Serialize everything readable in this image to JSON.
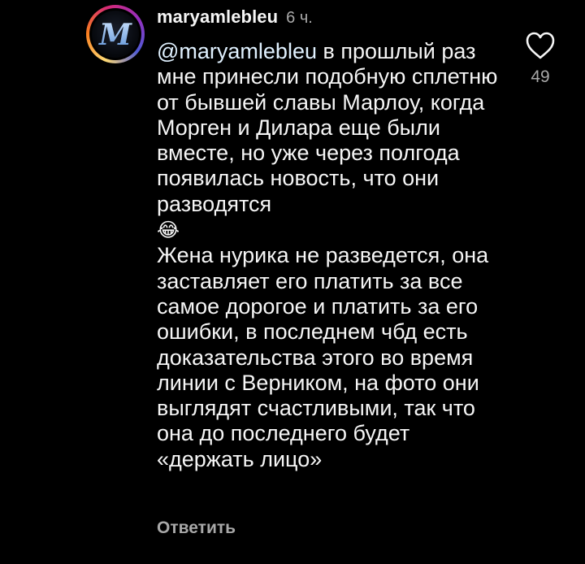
{
  "comment": {
    "username": "maryamlebleu",
    "time": "6 ч.",
    "mention": "@maryamlebleu",
    "text_part1": " в прошлый раз мне принесли подобную сплетню от бывшей славы Марлоу, когда Морген и Дилара еще были вместе, но уже через полгода появилась новость, что они разводятся",
    "emoji": "😂",
    "text_part2": "Жена нурика не разведется, она заставляет его платить за все самое дорогое и платить за его ошибки, в последнем чбд есть доказательства этого во время линии с Верником, на фото они выглядят счастливыми, так что она до последнего будет «держать лицо»",
    "reply_label": "Ответить",
    "like_count": "49",
    "avatar_letter": "M"
  },
  "icons": {
    "like": "heart-outline-icon",
    "avatar": "gothic-m-avatar"
  },
  "colors": {
    "background": "#000000",
    "text": "#f5f5f5",
    "muted": "#a8a8a8",
    "mention": "#e0f1ff"
  }
}
